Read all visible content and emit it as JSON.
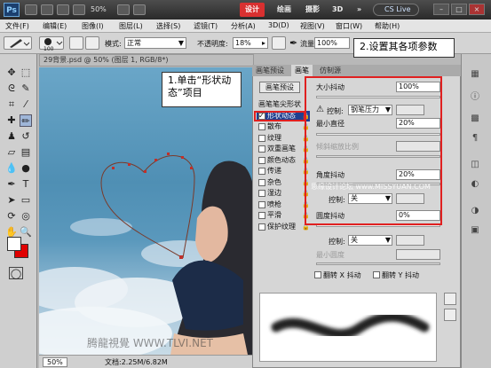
{
  "titlebar": {
    "app_logo": "Ps",
    "zoom": "50%",
    "workspaces": [
      "设计",
      "绘画",
      "摄影",
      "3D"
    ],
    "more": "»",
    "cslive": "CS Live",
    "win_controls": [
      "–",
      "□",
      "×"
    ]
  },
  "menu": [
    "文件(F)",
    "编辑(E)",
    "图像(I)",
    "图层(L)",
    "选择(S)",
    "滤镜(T)",
    "分析(A)",
    "3D(D)",
    "视图(V)",
    "窗口(W)",
    "帮助(H)"
  ],
  "options": {
    "brush_size": "100",
    "mode_label": "模式:",
    "mode_value": "正常",
    "opacity_label": "不透明度:",
    "opacity_value": "18%",
    "flow_label": "流量:",
    "flow_value": "100%"
  },
  "document": {
    "tab_title": "29背景.psd @ 50% (图层 1, RGB/8*)",
    "zoom": "50%",
    "doc_size": "文档:2.25M/6.82M"
  },
  "panel": {
    "tabs": [
      "画笔预设",
      "画笔",
      "仿制源"
    ],
    "preset_button": "画笔预设",
    "tip_shape_label": "画笔笔尖形状",
    "items": [
      {
        "label": "形状动态",
        "checked": true,
        "selected": true
      },
      {
        "label": "散布",
        "checked": false
      },
      {
        "label": "纹理",
        "checked": false
      },
      {
        "label": "双重画笔",
        "checked": false
      },
      {
        "label": "颜色动态",
        "checked": false
      },
      {
        "label": "传递",
        "checked": false
      },
      {
        "label": "杂色",
        "checked": false
      },
      {
        "label": "湿边",
        "checked": false
      },
      {
        "label": "喷枪",
        "checked": false
      },
      {
        "label": "平滑",
        "checked": false
      },
      {
        "label": "保护纹理",
        "checked": false
      }
    ],
    "size_jitter_label": "大小抖动",
    "size_jitter_value": "100%",
    "control1_label": "控制:",
    "control1_value": "钢笔压力",
    "min_diameter_label": "最小直径",
    "min_diameter_value": "20%",
    "tilt_scale_label": "倾斜缩放比例",
    "angle_jitter_label": "角度抖动",
    "angle_jitter_value": "20%",
    "control2_label": "控制:",
    "control2_value": "关",
    "roundness_jitter_label": "圆度抖动",
    "roundness_jitter_value": "0%",
    "control3_label": "控制:",
    "control3_value": "关",
    "min_roundness_label": "最小圆度",
    "flip_x_label": "翻转 X 抖动",
    "flip_y_label": "翻转 Y 抖动"
  },
  "callouts": {
    "step1": "1.单击“形状动态”项目",
    "step2": "2.设置其各项参数"
  },
  "watermarks": {
    "forum": "思缘设计论坛 www.MISSYUAN.COM",
    "site": "腾龍視覺 WWW.TLVI.NET"
  },
  "colors": {
    "accent_red": "#e02020",
    "selected_blue": "#1f3e8f",
    "foreground": "#ffffff",
    "background": "#e00000"
  }
}
